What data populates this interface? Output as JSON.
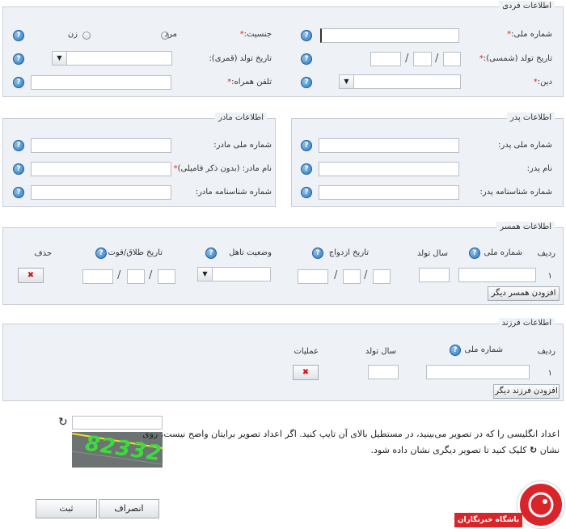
{
  "personal": {
    "legend": "اطلاعات فردی",
    "national_id_label": "شماره ملی:",
    "gender_label": "جنسیت:",
    "male": "مرد",
    "female": "زن",
    "birth_solar_label": "تاریخ تولد (شمسی):",
    "birth_lunar_label": "تاریخ تولد (قمری):",
    "religion_label": "دین:",
    "mobile_label": "تلفن همراه:",
    "required_mark": "*"
  },
  "father": {
    "legend": "اطلاعات پدر",
    "national_id_label": "شماره ملی پدر:",
    "name_label": "نام پدر:",
    "id_card_label": "شماره شناسنامه پدر:"
  },
  "mother": {
    "legend": "اطلاعات مادر",
    "national_id_label": "شماره ملی مادر:",
    "name_label": "نام مادر: (بدون ذکر فامیلی)",
    "id_card_label": "شماره شناسنامه مادر:"
  },
  "spouse": {
    "legend": "اطلاعات همسر",
    "col_row": "ردیف",
    "col_national_id": "شماره ملی",
    "col_birth_year": "سال تولد",
    "col_marriage_date": "تاریخ ازدواج",
    "col_marital_status": "وضعیت تاهل",
    "col_divorce_date": "تاریخ طلاق/فوت",
    "col_delete": "حذف",
    "row_number": "۱",
    "add_button": "افزودن همسر دیگر"
  },
  "children": {
    "legend": "اطلاعات فرزند",
    "col_row": "ردیف",
    "col_national_id": "شماره ملی",
    "col_birth_year": "سال تولد",
    "col_actions": "عملیات",
    "row_number": "۱",
    "add_button": "افزودن فرزند دیگر"
  },
  "captcha": {
    "instruction_line1": "اعداد انگلیسی را که در تصویر می‌بینید، در مستطیل بالای آن تایپ کنید. اگر اعداد تصویر برایتان واضح نیست، روی",
    "instruction_line2_a": "نشان",
    "instruction_line2_b": "کلیک کنید تا تصویر دیگری نشان داده شود.",
    "image_text": "82332"
  },
  "actions": {
    "submit": "ثبت",
    "cancel": "انصراف"
  },
  "watermark": {
    "text": "باشگاه خبرنگاران"
  },
  "icons": {
    "help": "?",
    "delete": "✖",
    "refresh": "↻",
    "dropdown": "▼"
  },
  "colors": {
    "panel_bg": "#eef1f6",
    "panel_border": "#c9ced6",
    "required": "#e0271b",
    "help_blue": "#2d78c0",
    "watermark_red": "#d9252a"
  }
}
